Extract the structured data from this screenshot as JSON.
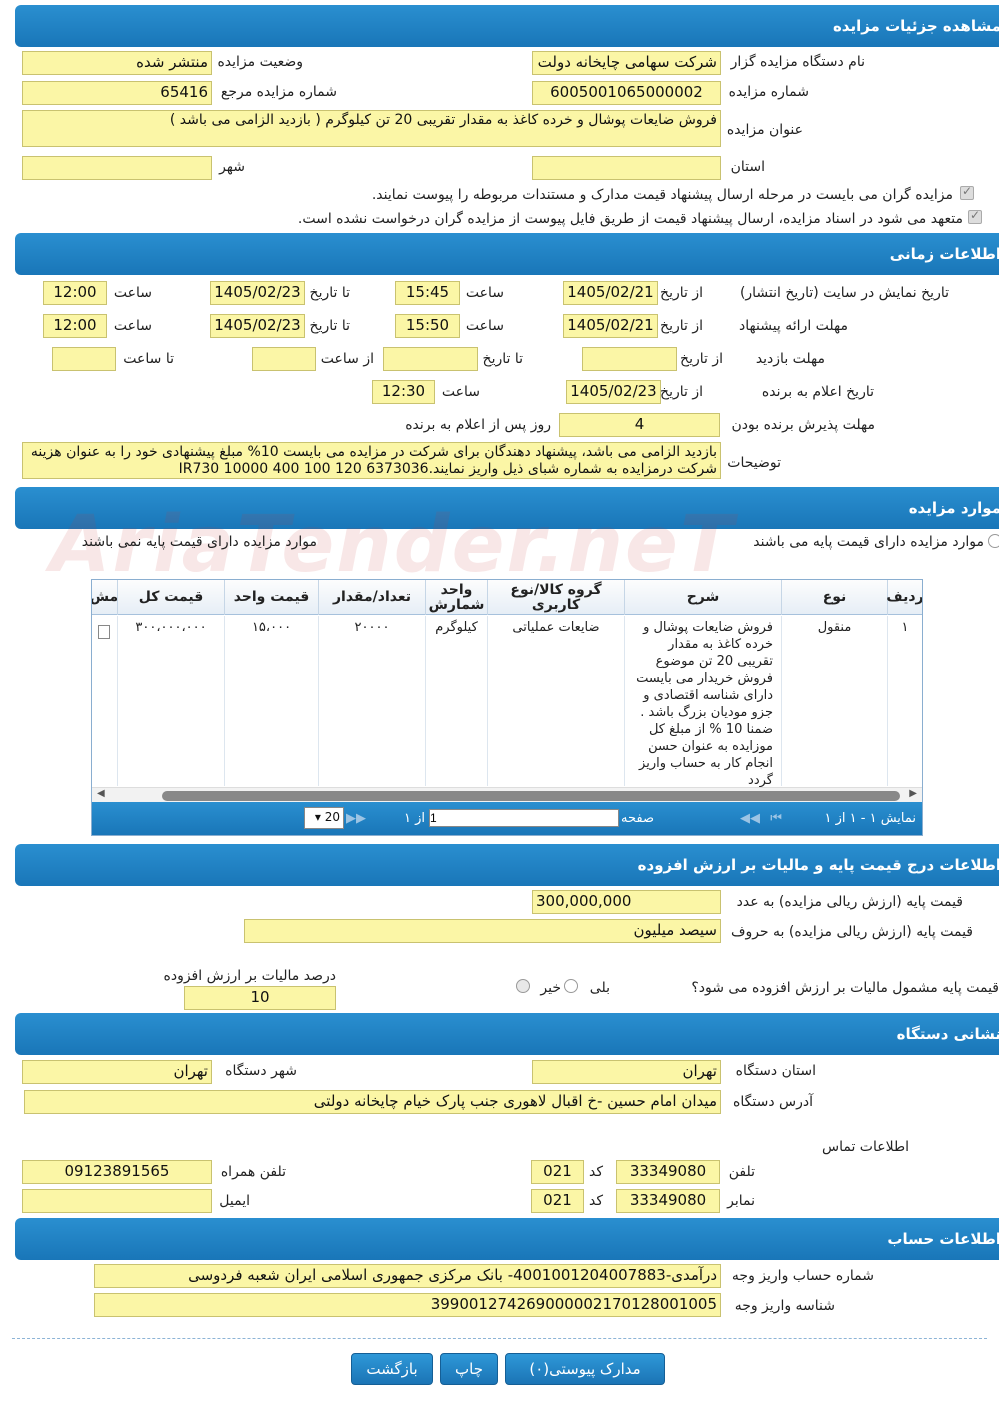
{
  "sections": {
    "details": "مشاهده جزئیات مزایده",
    "timing": "اطلاعات زمانی",
    "items": "موارد مزایده",
    "price": "اطلاعات درج قیمت پایه و مالیات بر ارزش افزوده",
    "address": "نشانی دستگاه",
    "account": "اطلاعات حساب"
  },
  "details": {
    "org_label": "نام دستگاه مزایده گزار",
    "org_value": "شرکت سهامی چایخانه دولت",
    "status_label": "وضعیت مزایده",
    "status_value": "منتشر شده",
    "number_label": "شماره مزایده",
    "number_value": "6005001065000002",
    "ref_label": "شماره مزایده مرجع",
    "ref_value": "65416",
    "title_label": "عنوان مزایده",
    "title_value": "فروش ضایعات پوشال و خرده کاغذ به مقدار تقریبی 20 تن کیلوگرم ( بازدید الزامی می باشد )",
    "province_label": "استان",
    "province_value": "",
    "city_label": "شهر",
    "city_value": "",
    "check1": "مزایده گران می بایست در مرحله ارسال پیشنهاد قیمت مدارک و مستندات مربوطه را پیوست نمایند.",
    "check2": "متعهد می شود در اسناد مزایده، ارسال پیشنهاد قیمت از طریق فایل پیوست از مزایده گران درخواست نشده است."
  },
  "timing": {
    "from_date": "از تاریخ",
    "to_date": "تا تاریخ",
    "hour": "ساعت",
    "from_hour": "از ساعت",
    "to_hour": "تا ساعت",
    "display_label": "تاریخ نمایش در سایت (تاریخ انتشار)",
    "display_from": "1405/02/21",
    "display_from_time": "15:45",
    "display_to": "1405/02/23",
    "display_to_time": "12:00",
    "offer_label": "مهلت ارائه پیشنهاد",
    "offer_from": "1405/02/21",
    "offer_from_time": "15:50",
    "offer_to": "1405/02/23",
    "offer_to_time": "12:00",
    "visit_label": "مهلت بازدید",
    "announce_label": "تاریخ اعلام به برنده",
    "announce_date": "1405/02/23",
    "announce_time": "12:30",
    "accept_label": "مهلت پذیرش برنده بودن",
    "accept_value": "4",
    "accept_suffix": "روز پس از اعلام به برنده",
    "desc_label": "توضیحات",
    "desc_value": "بازدید الزامی می باشد، پیشنهاد دهندگان برای شرکت در مزایده می بایست 10% مبلغ پیشنهادی خود را به عنوان هزینه شرکت درمزایده به شماره شبای ذیل واریز نمایند.6373036 120 100 400 10000 IR730"
  },
  "items": {
    "radio_base": "موارد مزایده دارای قیمت پایه می باشند",
    "radio_nobase": "موارد مزایده دارای قیمت پایه نمی باشند",
    "columns": [
      "ردیف",
      "نوع",
      "شرح",
      "گروه کالا/نوع کاربری",
      "واحد شمارش",
      "تعداد/مقدار",
      "قیمت واحد",
      "قیمت کل",
      "مش"
    ],
    "row": {
      "index": "۱",
      "type": "منقول",
      "desc": "فروش ضایعات پوشال و خرده کاغذ به مقدار تقریبی 20 تن موضوع فروش خریدار می بایست دارای شناسه اقتصادی و جزو مودیان بزرگ باشد . ضمنا 10 % از مبلغ کل موزایده به عنوان حسن انجام کار به حساب واریز گردد",
      "group": "ضایعات عملیاتی",
      "unit": "کیلوگرم",
      "qty": "۲۰۰۰۰",
      "unit_price": "۱۵،۰۰۰",
      "total": "۳۰۰،۰۰۰،۰۰۰"
    },
    "pager_display": "نمایش ۱ - ۱ از ۱",
    "pager_page": "صفحه",
    "pager_page_value": "1",
    "pager_of": "از ۱",
    "pager_size": "20"
  },
  "price": {
    "base_num_label": "قیمت پایه (ارزش ریالی مزایده) به عدد",
    "base_num_value": "300,000,000",
    "base_txt_label": "قیمت پایه (ارزش ریالی مزایده) به حروف",
    "base_txt_value": "سیصد میلیون",
    "vat_q": "قیمت پایه مشمول مالیات بر ارزش افزوده می شود؟",
    "yes": "بلی",
    "no": "خیر",
    "vat_pct_label": "درصد مالیات بر ارزش افزوده",
    "vat_pct_value": "10"
  },
  "address": {
    "province_label": "استان دستگاه",
    "province_value": "تهران",
    "city_label": "شهر دستگاه",
    "city_value": "تهران",
    "addr_label": "آدرس دستگاه",
    "addr_value": "میدان امام حسین -خ اقبال لاهوری جنب پارک خیام چایخانه دولتی",
    "contact_label": "اطلاعات تماس",
    "phone_label": "تلفن",
    "phone_value": "33349080",
    "code_label": "کد",
    "phone_code": "021",
    "mobile_label": "تلفن همراه",
    "mobile_value": "09123891565",
    "fax_label": "نمابر",
    "fax_value": "33349080",
    "fax_code": "021",
    "email_label": "ایمیل",
    "email_value": ""
  },
  "account": {
    "acc_label": "شماره حساب واریز وجه",
    "acc_value": "درآمدی-4001001204007883- بانک مرکزی جمهوری اسلامی ایران شعبه فردوسی",
    "id_label": "شناسه واریز وجه",
    "id_value": "399001274269000002170128001005"
  },
  "buttons": {
    "attachments": "مدارک پیوستی(۰)",
    "print": "چاپ",
    "back": "بازگشت"
  },
  "watermark": "AriaTender.neT"
}
